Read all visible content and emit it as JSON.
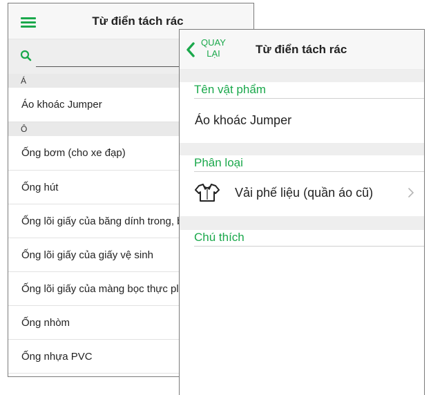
{
  "list_screen": {
    "title": "Từ điển tách rác",
    "search_placeholder": "",
    "sections": [
      {
        "letter": "Á",
        "items": [
          "Áo khoác Jumper"
        ]
      },
      {
        "letter": "Ô",
        "items": [
          "Ống bơm (cho xe đạp)",
          "Ống hút",
          "Ống lõi giấy của băng dính trong, b",
          "Ống lõi giấy của giấy vệ sinh",
          "Ống lõi giấy của màng bọc thực pl",
          "Ống nhòm",
          "Ống nhựa PVC"
        ]
      }
    ]
  },
  "detail_screen": {
    "back_label_line1": "QUAY",
    "back_label_line2": "LẠI",
    "title": "Từ điển tách rác",
    "item_name_label": "Tên vật phẩm",
    "item_name_value": "Áo khoác Jumper",
    "category_label": "Phân loại",
    "category_value": "Vải phế liệu (quần áo cũ)",
    "category_icon": "shirt-icon",
    "note_label": "Chú thích"
  },
  "colors": {
    "accent": "#1aa84b",
    "section_bg": "#eeeeee",
    "header_bg": "#f7f7f7"
  }
}
